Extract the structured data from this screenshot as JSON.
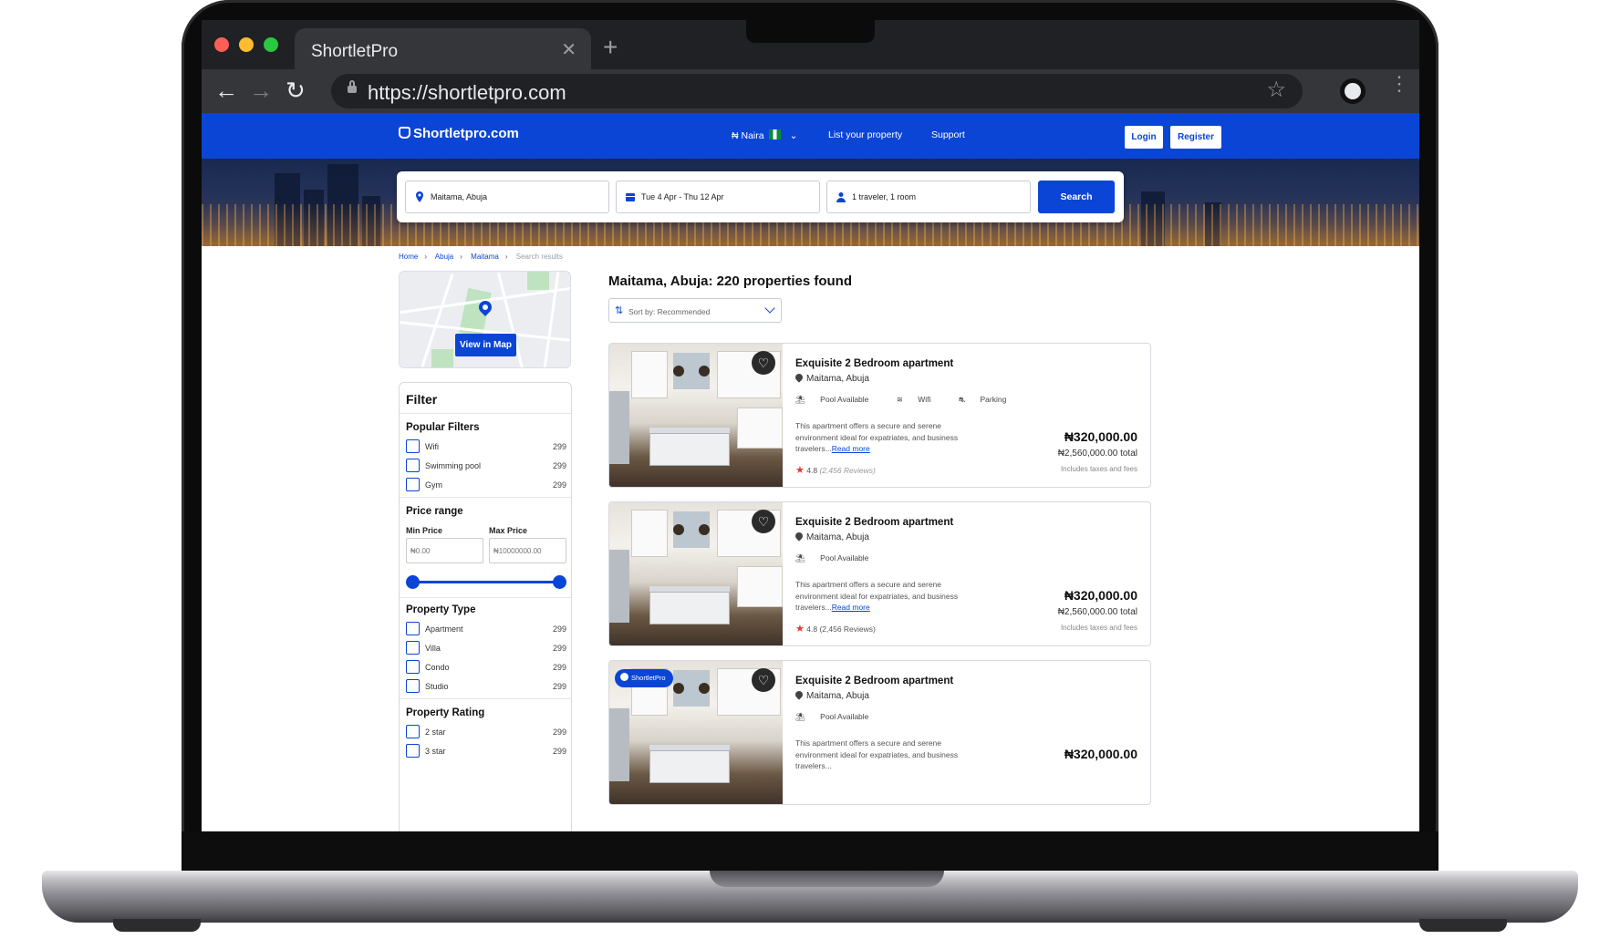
{
  "browser": {
    "tab_title": "ShortletPro",
    "url": "https://shortletpro.com"
  },
  "site": {
    "logo": "Shortletpro.com",
    "currency": "₦ Naira",
    "nav": [
      "List your property",
      "Support"
    ],
    "login_label": "Login",
    "register_label": "Register"
  },
  "search": {
    "location": "Maitama, Abuja",
    "dates": "Tue 4 Apr - Thu 12 Apr",
    "guests": "1 traveler, 1 room",
    "button": "Search"
  },
  "breadcrumbs": [
    "Home",
    "Abuja",
    "Maitama",
    "Search results"
  ],
  "map": {
    "button": "View in Map"
  },
  "filter": {
    "title": "Filter",
    "popular": {
      "title": "Popular Filters",
      "items": [
        {
          "label": "Wifi",
          "count": "299"
        },
        {
          "label": "Swimming pool",
          "count": "299"
        },
        {
          "label": "Gym",
          "count": "299"
        }
      ]
    },
    "price": {
      "title": "Price range",
      "min_label": "Min Price",
      "max_label": "Max Price",
      "min_value": "₦0.00",
      "max_value": "₦10000000.00"
    },
    "property_type": {
      "title": "Property Type",
      "items": [
        {
          "label": "Apartment",
          "count": "299"
        },
        {
          "label": "Villa",
          "count": "299"
        },
        {
          "label": "Condo",
          "count": "299"
        },
        {
          "label": "Studio",
          "count": "299"
        }
      ]
    },
    "rating": {
      "title": "Property Rating",
      "items": [
        {
          "label": "2 star",
          "count": "299"
        },
        {
          "label": "3 star",
          "count": "299"
        }
      ]
    }
  },
  "results": {
    "title": "Maitama, Abuja: 220 properties found",
    "sort_label": "Sort by: Recommended",
    "cards": [
      {
        "title": "Exquisite 2 Bedroom apartment",
        "location": "Maitama, Abuja",
        "amenities": [
          "Pool Available",
          "Wifi",
          "Parking"
        ],
        "description": "This apartment offers a secure and serene environment ideal for expatriates, and business travelers...",
        "read_more": "Read more",
        "rating": "4.8",
        "reviews": "(2,456 Reviews)",
        "price": "₦320,000.00",
        "total": "₦2,560,000.00 total",
        "fees": "Includes taxes and fees"
      },
      {
        "title": "Exquisite 2 Bedroom apartment",
        "location": "Maitama, Abuja",
        "amenities": [
          "Pool Available"
        ],
        "description": "This apartment offers a secure and serene environment ideal for expatriates, and business travelers...",
        "read_more": "Read more",
        "rating": "4.8",
        "reviews": "(2,456 Reviews)",
        "price": "₦320,000.00",
        "total": "₦2,560,000.00 total",
        "fees": "Includes taxes and fees"
      },
      {
        "badge": "ShortletPro",
        "title": "Exquisite 2 Bedroom apartment",
        "location": "Maitama, Abuja",
        "amenities": [
          "Pool Available"
        ],
        "description": "This apartment offers a secure and serene environment ideal for expatriates, and business travelers...",
        "price": "₦320,000.00"
      }
    ]
  },
  "colors": {
    "brand": "#0b45d6",
    "rating_star": "#e53935"
  }
}
